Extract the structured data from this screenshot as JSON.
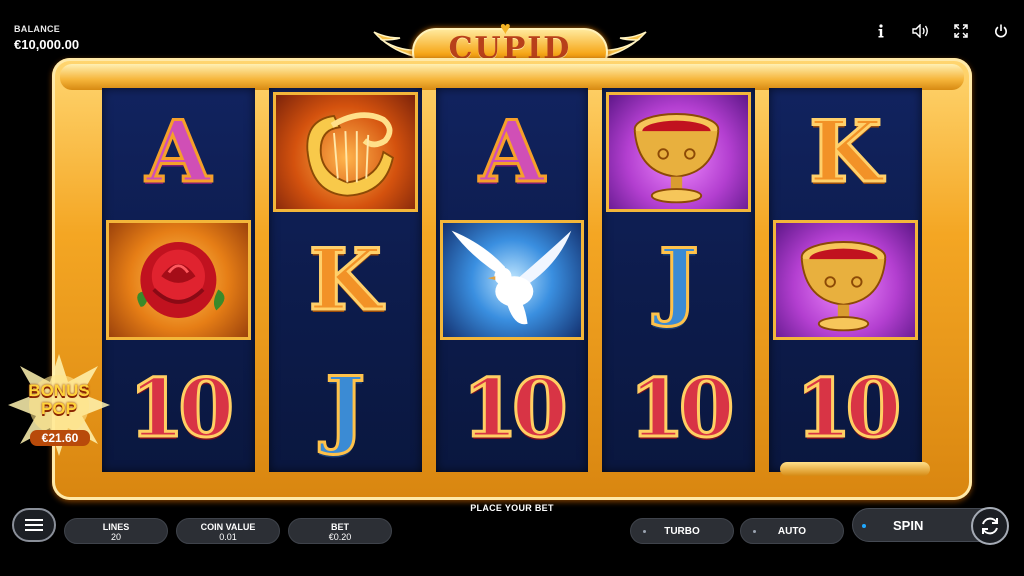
{
  "header": {
    "balance_label": "BALANCE",
    "balance_value": "€10,000.00",
    "icons": [
      "info-icon",
      "sound-icon",
      "fullscreen-icon",
      "power-icon"
    ]
  },
  "logo": {
    "text": "CUPID"
  },
  "reels": [
    [
      "A",
      "rose",
      "10"
    ],
    [
      "lyre",
      "K",
      "J"
    ],
    [
      "A",
      "dove",
      "10"
    ],
    [
      "goblet",
      "J",
      "10"
    ],
    [
      "K",
      "goblet",
      "10"
    ]
  ],
  "symbols": {
    "A": "A",
    "K": "K",
    "J": "J",
    "ten": "10"
  },
  "bonus": {
    "line1": "BONUS",
    "line2": "POP",
    "amount": "€21.60"
  },
  "bottom": {
    "message": "PLACE YOUR BET",
    "lines_label": "LINES",
    "lines_value": "20",
    "coin_label": "COIN VALUE",
    "coin_value": "0.01",
    "bet_label": "BET",
    "bet_value": "€0.20",
    "turbo_label": "TURBO",
    "auto_label": "AUTO",
    "spin_label": "SPIN"
  },
  "colors": {
    "frame_gold": "#f4a623",
    "reel_bg": "#0d1c4d",
    "accent_blue": "#1fa8ff"
  }
}
